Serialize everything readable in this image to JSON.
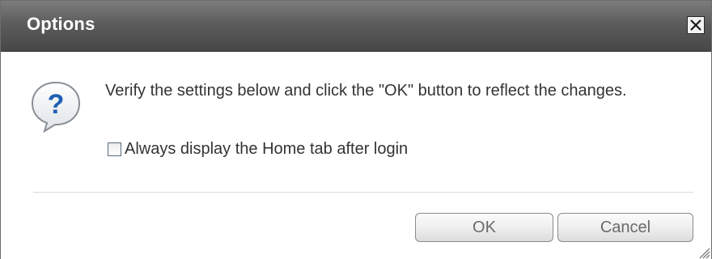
{
  "dialog": {
    "title": "Options",
    "close_icon": "close-icon",
    "message_icon": "question-icon",
    "message": "Verify the settings below and click the \"OK\" button to reflect the changes.",
    "checkbox": {
      "label": "Always display the Home tab after login",
      "checked": false
    },
    "buttons": {
      "ok_label": "OK",
      "cancel_label": "Cancel"
    },
    "resize_icon": "resize-grip-icon"
  },
  "colors": {
    "titlebar_top": "#7d7d7d",
    "titlebar_bottom": "#474747",
    "title_text": "#ffffff",
    "body_text": "#333333",
    "icon_blue": "#1f5fb3",
    "divider": "#d3dbe3"
  }
}
